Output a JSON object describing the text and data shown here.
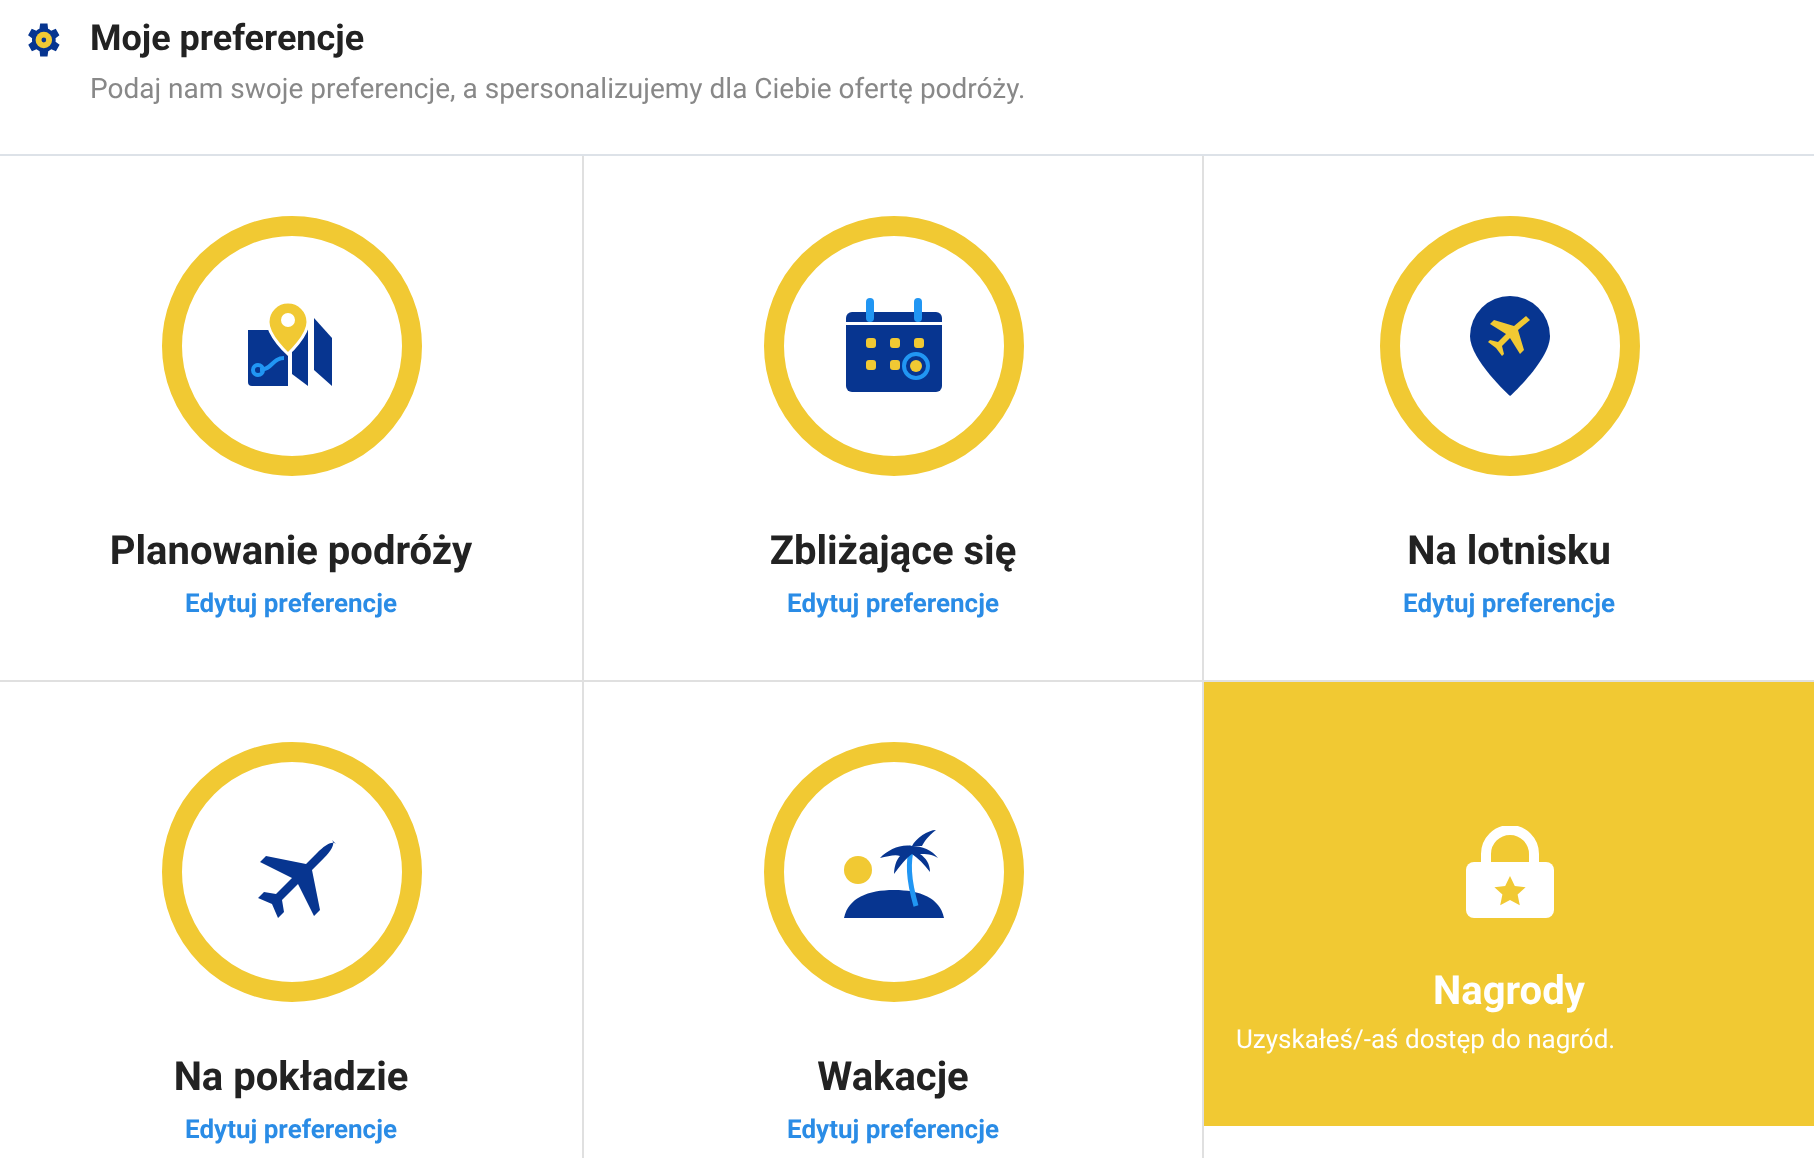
{
  "header": {
    "title": "Moje preferencje",
    "subtitle": "Podaj nam swoje preferencje, a spersonalizujemy dla Ciebie ofertę podróży."
  },
  "tiles": [
    {
      "kind": "preference",
      "title": "Planowanie podróży",
      "link": "Edytuj preferencje"
    },
    {
      "kind": "preference",
      "title": "Zbliżające się",
      "link": "Edytuj preferencje"
    },
    {
      "kind": "preference",
      "title": "Na lotnisku",
      "link": "Edytuj preferencje"
    },
    {
      "kind": "preference",
      "title": "Na pokładzie",
      "link": "Edytuj preferencje"
    },
    {
      "kind": "preference",
      "title": "Wakacje",
      "link": "Edytuj preferencje"
    },
    {
      "kind": "reward",
      "title": "Nagrody",
      "text": "Uzyskałeś/-aś dostęp do nagród."
    }
  ]
}
